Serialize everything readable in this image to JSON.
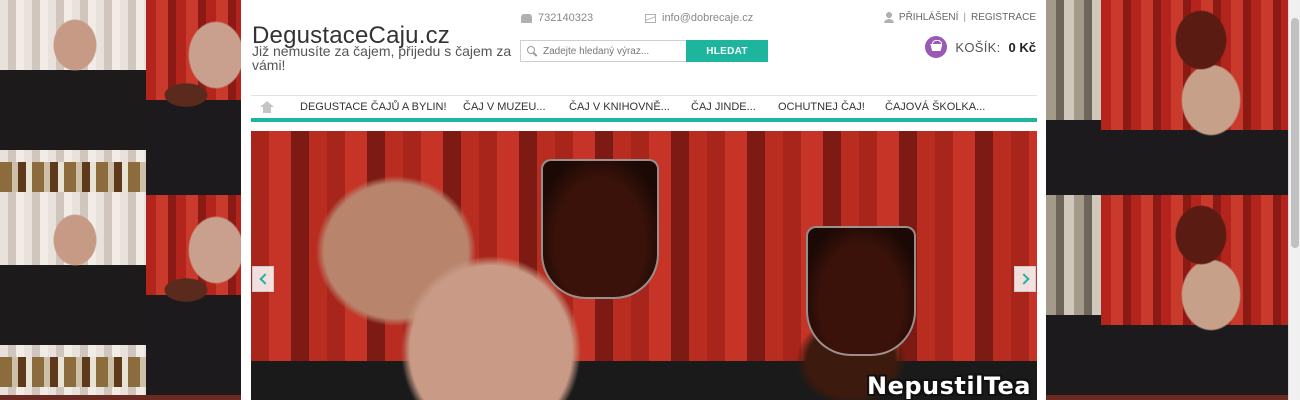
{
  "site": {
    "title": "DegustaceCaju.cz",
    "tagline": "Již nemusíte za čajem, přijedu s čajem za vámi!"
  },
  "contact": {
    "phone": "732140323",
    "email": "info@dobrecaje.cz",
    "phone_icon": "phone-icon",
    "email_icon": "mail-icon"
  },
  "user": {
    "login": "PŘIHLÁŠENÍ",
    "separator": "|",
    "register": "REGISTRACE"
  },
  "search": {
    "placeholder": "Zadejte hledaný výraz...",
    "value": "",
    "button": "HLEDAT"
  },
  "cart": {
    "label": "KOŠÍK:",
    "price": "0 Kč"
  },
  "nav": {
    "items": [
      {
        "label": "DEGUSTACE ČAJŮ A BYLIN!"
      },
      {
        "label": "ČAJ V MUZEU..."
      },
      {
        "label": "ČAJ V KNIHOVNĚ..."
      },
      {
        "label": "ČAJ JINDE..."
      },
      {
        "label": "OCHUTNEJ ČAJ!"
      },
      {
        "label": "ČAJOVÁ ŠKOLKA..."
      }
    ]
  },
  "slider": {
    "caption": "NepustilTea"
  },
  "colors": {
    "accent": "#1eb59f",
    "cart_icon": "#9b59b6",
    "content_bg": "#ffffff"
  }
}
